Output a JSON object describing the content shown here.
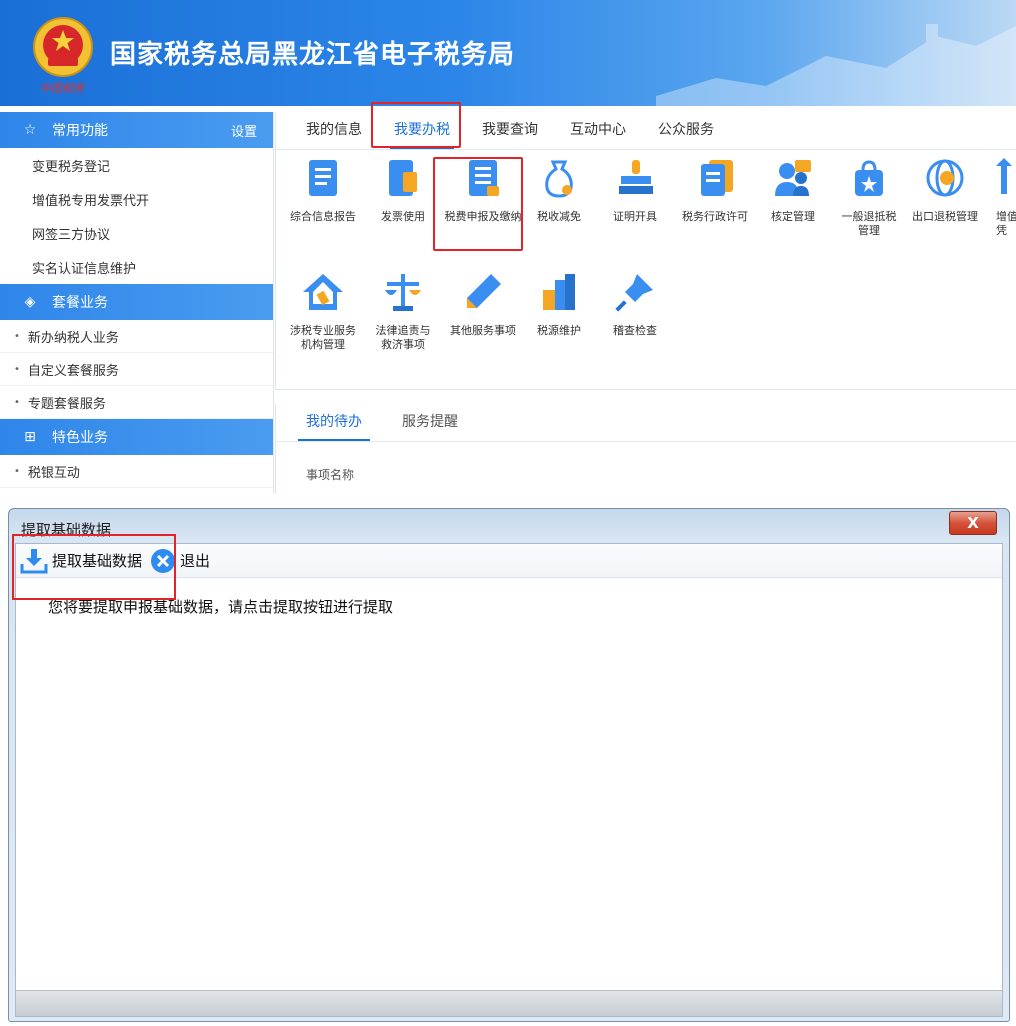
{
  "banner": {
    "title": "国家税务总局黑龙江省电子税务局",
    "emblem_caption": "中国税务"
  },
  "sidebar": {
    "common": {
      "label": "常用功能",
      "settings": "设置",
      "icon": "star-icon"
    },
    "common_items": [
      "变更税务登记",
      "增值税专用发票代开",
      "网签三方协议",
      "实名认证信息维护"
    ],
    "package": {
      "label": "套餐业务",
      "icon": "layers-icon"
    },
    "package_items": [
      "新办纳税人业务",
      "自定义套餐服务",
      "专题套餐服务"
    ],
    "special": {
      "label": "特色业务",
      "icon": "grid-icon"
    },
    "special_items": [
      "税银互动"
    ]
  },
  "tabs": [
    "我的信息",
    "我要办税",
    "我要查询",
    "互动中心",
    "公众服务"
  ],
  "active_tab": "我要办税",
  "services_row1": [
    {
      "label": "综合信息报告",
      "icon": "book-icon"
    },
    {
      "label": "发票使用",
      "icon": "invoice-icon"
    },
    {
      "label": "税费申报及缴纳",
      "icon": "document-list-icon"
    },
    {
      "label": "税收减免",
      "icon": "money-bag-icon"
    },
    {
      "label": "证明开具",
      "icon": "certificate-stamp-icon"
    },
    {
      "label": "税务行政许可",
      "icon": "notebook-icon"
    },
    {
      "label": "核定管理",
      "icon": "people-icon"
    },
    {
      "label": "一般退抵税\n管理",
      "icon": "shopping-bag-icon"
    },
    {
      "label": "出口退税管理",
      "icon": "globe-icon"
    },
    {
      "label": "增值\n凭",
      "icon": "arrow-up-icon"
    }
  ],
  "services_row2": [
    {
      "label": "涉税专业服务\n机构管理",
      "icon": "house-wrench-icon"
    },
    {
      "label": "法律追责与\n救济事项",
      "icon": "scales-icon"
    },
    {
      "label": "其他服务事项",
      "icon": "pen-icon"
    },
    {
      "label": "税源维护",
      "icon": "buildings-icon"
    },
    {
      "label": "稽查检查",
      "icon": "pin-icon"
    }
  ],
  "todo": {
    "tabs": [
      "我的待办",
      "服务提醒"
    ],
    "column": "事项名称"
  },
  "dialog": {
    "title": "提取基础数据",
    "close": "X",
    "fetch_button": "提取基础数据",
    "exit_button": "退出",
    "message": "您将要提取申报基础数据，请点击提取按钮进行提取"
  },
  "colors": {
    "accent": "#1d6fd8",
    "highlight": "#e0242a",
    "icon_blue": "#2d8cf0"
  }
}
